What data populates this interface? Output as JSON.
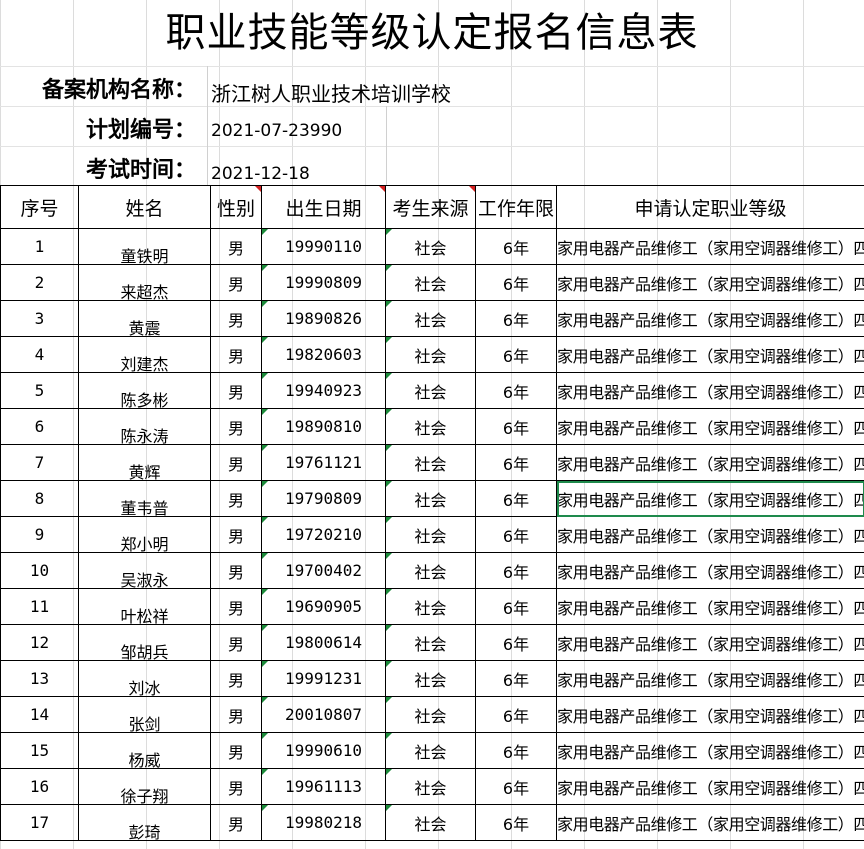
{
  "title": "职业技能等级认定报名信息表",
  "meta": [
    {
      "label": "备案机构名称：",
      "value": "浙江树人职业技术培训学校"
    },
    {
      "label": "计划编号：",
      "value": "2021-07-23990"
    },
    {
      "label": "考试时间：",
      "value": "2021-12-18"
    }
  ],
  "columns": [
    "序号",
    "姓名",
    "性别",
    "出生日期",
    "考生来源",
    "工作年限",
    "申请认定职业等级"
  ],
  "rows": [
    {
      "no": "1",
      "name": "童铁明",
      "gender": "男",
      "dob": "19990110",
      "source": "社会",
      "years": "6年",
      "occupation": "家用电器产品维修工（家用空调器维修工）四级"
    },
    {
      "no": "2",
      "name": "来超杰",
      "gender": "男",
      "dob": "19990809",
      "source": "社会",
      "years": "6年",
      "occupation": "家用电器产品维修工（家用空调器维修工）四级"
    },
    {
      "no": "3",
      "name": "黄震",
      "gender": "男",
      "dob": "19890826",
      "source": "社会",
      "years": "6年",
      "occupation": "家用电器产品维修工（家用空调器维修工）四级"
    },
    {
      "no": "4",
      "name": "刘建杰",
      "gender": "男",
      "dob": "19820603",
      "source": "社会",
      "years": "6年",
      "occupation": "家用电器产品维修工（家用空调器维修工）四级"
    },
    {
      "no": "5",
      "name": "陈多彬",
      "gender": "男",
      "dob": "19940923",
      "source": "社会",
      "years": "6年",
      "occupation": "家用电器产品维修工（家用空调器维修工）四级"
    },
    {
      "no": "6",
      "name": "陈永涛",
      "gender": "男",
      "dob": "19890810",
      "source": "社会",
      "years": "6年",
      "occupation": "家用电器产品维修工（家用空调器维修工）四级"
    },
    {
      "no": "7",
      "name": "黄辉",
      "gender": "男",
      "dob": "19761121",
      "source": "社会",
      "years": "6年",
      "occupation": "家用电器产品维修工（家用空调器维修工）四级"
    },
    {
      "no": "8",
      "name": "董韦普",
      "gender": "男",
      "dob": "19790809",
      "source": "社会",
      "years": "6年",
      "occupation": "家用电器产品维修工（家用空调器维修工）四级"
    },
    {
      "no": "9",
      "name": "郑小明",
      "gender": "男",
      "dob": "19720210",
      "source": "社会",
      "years": "6年",
      "occupation": "家用电器产品维修工（家用空调器维修工）四级"
    },
    {
      "no": "10",
      "name": "吴淑永",
      "gender": "男",
      "dob": "19700402",
      "source": "社会",
      "years": "6年",
      "occupation": "家用电器产品维修工（家用空调器维修工）四级"
    },
    {
      "no": "11",
      "name": "叶松祥",
      "gender": "男",
      "dob": "19690905",
      "source": "社会",
      "years": "6年",
      "occupation": "家用电器产品维修工（家用空调器维修工）四级"
    },
    {
      "no": "12",
      "name": "邹胡兵",
      "gender": "男",
      "dob": "19800614",
      "source": "社会",
      "years": "6年",
      "occupation": "家用电器产品维修工（家用空调器维修工）四级"
    },
    {
      "no": "13",
      "name": "刘冰",
      "gender": "男",
      "dob": "19991231",
      "source": "社会",
      "years": "6年",
      "occupation": "家用电器产品维修工（家用空调器维修工）四级"
    },
    {
      "no": "14",
      "name": "张剑",
      "gender": "男",
      "dob": "20010807",
      "source": "社会",
      "years": "6年",
      "occupation": "家用电器产品维修工（家用空调器维修工）四级"
    },
    {
      "no": "15",
      "name": "杨威",
      "gender": "男",
      "dob": "19990610",
      "source": "社会",
      "years": "6年",
      "occupation": "家用电器产品维修工（家用空调器维修工）四级"
    },
    {
      "no": "16",
      "name": "徐子翔",
      "gender": "男",
      "dob": "19961113",
      "source": "社会",
      "years": "6年",
      "occupation": "家用电器产品维修工（家用空调器维修工）四级"
    },
    {
      "no": "17",
      "name": "彭琦",
      "gender": "男",
      "dob": "19980218",
      "source": "社会",
      "years": "6年",
      "occupation": "家用电器产品维修工（家用空调器维修工）四级"
    }
  ],
  "selected_row": "8",
  "colors": {
    "selection": "#1e8a4c",
    "comment_marker": "#d42020",
    "number_marker": "#1b8a3a",
    "gridline": "#dcdcdc"
  }
}
